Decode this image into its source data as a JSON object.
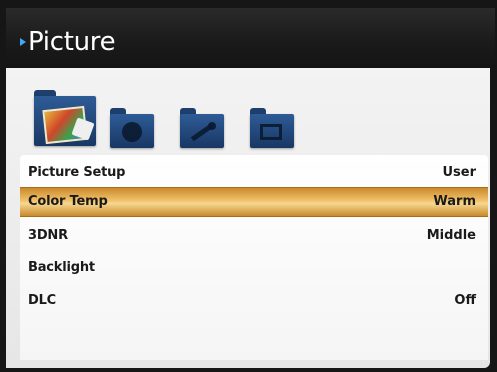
{
  "header": {
    "title": "Picture",
    "marker_color": "#3fa9f5"
  },
  "icon_strip": {
    "icons": [
      {
        "name": "picture-folder-icon",
        "selected": true
      },
      {
        "name": "camera-folder-icon",
        "selected": false
      },
      {
        "name": "tools-folder-icon",
        "selected": false
      },
      {
        "name": "screen-folder-icon",
        "selected": false
      }
    ]
  },
  "menu": {
    "selected_index": 1,
    "highlight_color": "#f2c26a",
    "items": [
      {
        "label": "Picture Setup",
        "value": "User"
      },
      {
        "label": "Color Temp",
        "value": "Warm"
      },
      {
        "label": "3DNR",
        "value": "Middle"
      },
      {
        "label": "Backlight",
        "value": ""
      },
      {
        "label": "DLC",
        "value": "Off"
      }
    ]
  }
}
